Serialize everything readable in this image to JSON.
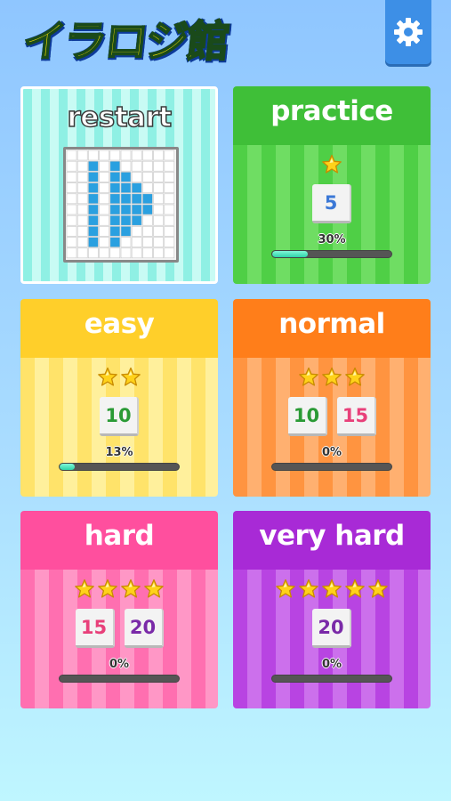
{
  "logo": {
    "text": "イラロジ館"
  },
  "settings": {
    "icon": "gear-icon"
  },
  "cards": {
    "restart": {
      "title": "restart"
    },
    "practice": {
      "title": "practice",
      "stars": 1,
      "numbers": [
        "5"
      ],
      "number_colors": [
        "#3b78d6"
      ],
      "progress_label": "30%",
      "progress": 0.3
    },
    "easy": {
      "title": "easy",
      "stars": 2,
      "numbers": [
        "10"
      ],
      "number_colors": [
        "#2a9a35"
      ],
      "progress_label": "13%",
      "progress": 0.13
    },
    "normal": {
      "title": "normal",
      "stars": 3,
      "numbers": [
        "10",
        "15"
      ],
      "number_colors": [
        "#2a9a35",
        "#e8407a"
      ],
      "progress_label": "0%",
      "progress": 0
    },
    "hard": {
      "title": "hard",
      "stars": 4,
      "numbers": [
        "15",
        "20"
      ],
      "number_colors": [
        "#e8407a",
        "#7a2aa8"
      ],
      "progress_label": "0%",
      "progress": 0
    },
    "very_hard": {
      "title": "very hard",
      "stars": 5,
      "numbers": [
        "20"
      ],
      "number_colors": [
        "#7a2aa8"
      ],
      "progress_label": "0%",
      "progress": 0
    }
  },
  "colors": {
    "practice": "#48c840",
    "easy": "#ffd83a",
    "normal": "#ff8a2a",
    "hard": "#ff5fa8",
    "very_hard": "#b63adf",
    "restart": "#7fe8dc",
    "star": "#ffd21a"
  }
}
